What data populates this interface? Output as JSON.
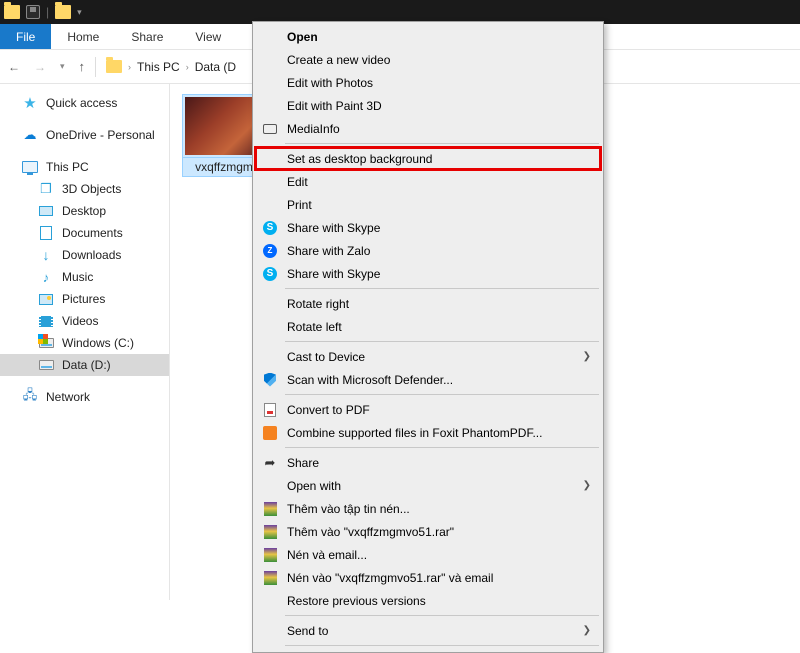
{
  "ribbon": {
    "file": "File",
    "home": "Home",
    "share": "Share",
    "view": "View"
  },
  "breadcrumb": {
    "pc": "This PC",
    "drive": "Data (D"
  },
  "sidebar": {
    "quick": "Quick access",
    "onedrive": "OneDrive - Personal",
    "pc": "This PC",
    "obj3d": "3D Objects",
    "desktop": "Desktop",
    "documents": "Documents",
    "downloads": "Downloads",
    "music": "Music",
    "pictures": "Pictures",
    "videos": "Videos",
    "winc": "Windows (C:)",
    "datad": "Data (D:)",
    "network": "Network"
  },
  "file": {
    "name": "vxqffzmgm"
  },
  "ctx": {
    "open": "Open",
    "newvideo": "Create a new video",
    "editphotos": "Edit with Photos",
    "paint3d": "Edit with Paint 3D",
    "mediainfo": "MediaInfo",
    "setbg": "Set as desktop background",
    "edit": "Edit",
    "print": "Print",
    "skype1": "Share with Skype",
    "zalo": "Share with Zalo",
    "skype2": "Share with Skype",
    "rotr": "Rotate right",
    "rotl": "Rotate left",
    "cast": "Cast to Device",
    "defender": "Scan with Microsoft Defender...",
    "convpdf": "Convert to PDF",
    "foxit": "Combine supported files in Foxit PhantomPDF...",
    "share": "Share",
    "openwith": "Open with",
    "rar_add": "Thêm vào tập tin nén...",
    "rar_addname": "Thêm vào \"vxqffzmgmvo51.rar\"",
    "rar_email": "Nén và email...",
    "rar_nameemail": "Nén vào \"vxqffzmgmvo51.rar\" và email",
    "restore": "Restore previous versions",
    "sendto": "Send to"
  }
}
